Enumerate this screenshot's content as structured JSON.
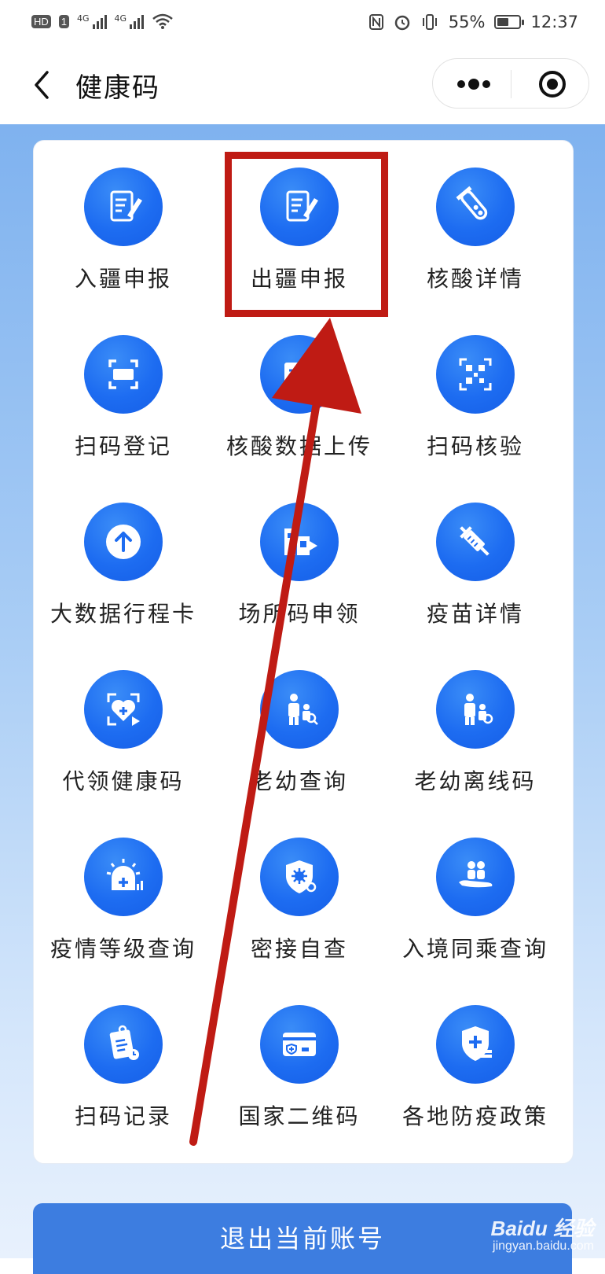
{
  "status_bar": {
    "hd_badge": "HD",
    "sim1_badge": "1",
    "network_1": "4G",
    "network_2": "4G",
    "battery_percent": "55%",
    "battery_level": 0.55,
    "time": "12:37"
  },
  "navbar": {
    "title": "健康码",
    "back_icon": "chevron-left-icon",
    "more_icon": "more-dots-icon",
    "close_icon": "target-icon"
  },
  "services": [
    {
      "label": "入疆申报",
      "icon": "notebook-pen-icon"
    },
    {
      "label": "出疆申报",
      "icon": "notebook-pen-icon"
    },
    {
      "label": "核酸详情",
      "icon": "test-tube-icon"
    },
    {
      "label": "扫码登记",
      "icon": "scan-icon"
    },
    {
      "label": "核酸数据上传",
      "icon": "upload-card-icon"
    },
    {
      "label": "扫码核验",
      "icon": "qr-verify-icon"
    },
    {
      "label": "大数据行程卡",
      "icon": "arrow-up-circle-icon"
    },
    {
      "label": "场所码申领",
      "icon": "venue-code-icon"
    },
    {
      "label": "疫苗详情",
      "icon": "syringe-icon"
    },
    {
      "label": "代领健康码",
      "icon": "heart-scan-icon"
    },
    {
      "label": "老幼查询",
      "icon": "elder-child-search-icon"
    },
    {
      "label": "老幼离线码",
      "icon": "elder-child-offline-icon"
    },
    {
      "label": "疫情等级查询",
      "icon": "alert-level-icon"
    },
    {
      "label": "密接自查",
      "icon": "virus-shield-icon"
    },
    {
      "label": "入境同乘查询",
      "icon": "plane-passengers-icon"
    },
    {
      "label": "扫码记录",
      "icon": "clipboard-record-icon"
    },
    {
      "label": "国家二维码",
      "icon": "id-card-icon"
    },
    {
      "label": "各地防疫政策",
      "icon": "shield-plus-icon"
    }
  ],
  "logout_button": "退出当前账号",
  "watermark": {
    "brand": "Baidu 经验",
    "url": "jingyan.baidu.com"
  },
  "colors": {
    "accent": "#1d6cf1",
    "highlight": "#bf1b14",
    "logout": "#3d7de0"
  }
}
